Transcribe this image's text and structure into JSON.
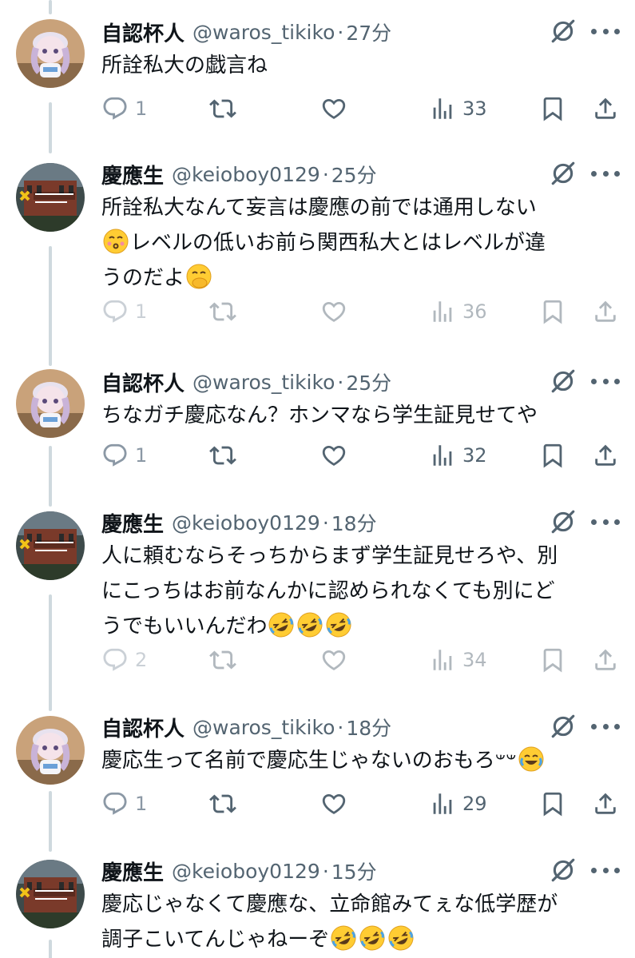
{
  "tweets": [
    {
      "name": "自認杯人",
      "handle": "@waros_tikiko",
      "dot": "·",
      "time": "27分",
      "text": "所詮私大の戯言ね",
      "emojis": [],
      "replies": "1",
      "views": "33",
      "faded": false,
      "avatar": "plush"
    },
    {
      "name": "慶應生",
      "handle": "@keioboy0129",
      "dot": "·",
      "time": "25分",
      "text_parts": [
        "所詮私大なんて妄言は慶應の前では通用しない\n",
        "kiss",
        "レベルの低いお前ら関西私大とはレベルが違\nうのだよ",
        "hand-over-mouth"
      ],
      "replies": "1",
      "views": "36",
      "faded": true,
      "avatar": "keio"
    },
    {
      "name": "自認杯人",
      "handle": "@waros_tikiko",
      "dot": "·",
      "time": "25分",
      "text": "ちなガチ慶応なん？ホンマなら学生証見せてや",
      "replies": "1",
      "views": "32",
      "faded": false,
      "avatar": "plush"
    },
    {
      "name": "慶應生",
      "handle": "@keioboy0129",
      "dot": "·",
      "time": "18分",
      "text_parts": [
        "人に頼むならそっちからまず学生証見せろや、別\nにこっちはお前なんかに認められなくても別にど\nうでもいいんだわ",
        "rofl",
        "rofl",
        "rofl"
      ],
      "replies": "2",
      "views": "34",
      "faded": true,
      "avatar": "keio"
    },
    {
      "name": "自認杯人",
      "handle": "@waros_tikiko",
      "dot": "·",
      "time": "18分",
      "text_parts": [
        "慶応生って名前で慶応生じゃないのおもろ𐤔𐤔",
        "joy"
      ],
      "replies": "1",
      "views": "29",
      "faded": false,
      "avatar": "plush"
    },
    {
      "name": "慶應生",
      "handle": "@keioboy0129",
      "dot": "·",
      "time": "15分",
      "text_parts": [
        "慶応じゃなくて慶應な、立命館みてぇな低学歴が\n調子こいてんじゃねーぞ",
        "rofl",
        "rofl",
        "rofl"
      ],
      "replies": "",
      "views": "",
      "faded": true,
      "avatar": "keio"
    }
  ],
  "icons": [
    "reply-icon",
    "retweet-icon",
    "like-icon",
    "views-icon",
    "bookmark-icon",
    "share-icon",
    "grok-icon",
    "more-icon"
  ],
  "colors": {
    "text": "#0f1419",
    "secondary": "#536471",
    "thread_line": "#cfd9de"
  }
}
